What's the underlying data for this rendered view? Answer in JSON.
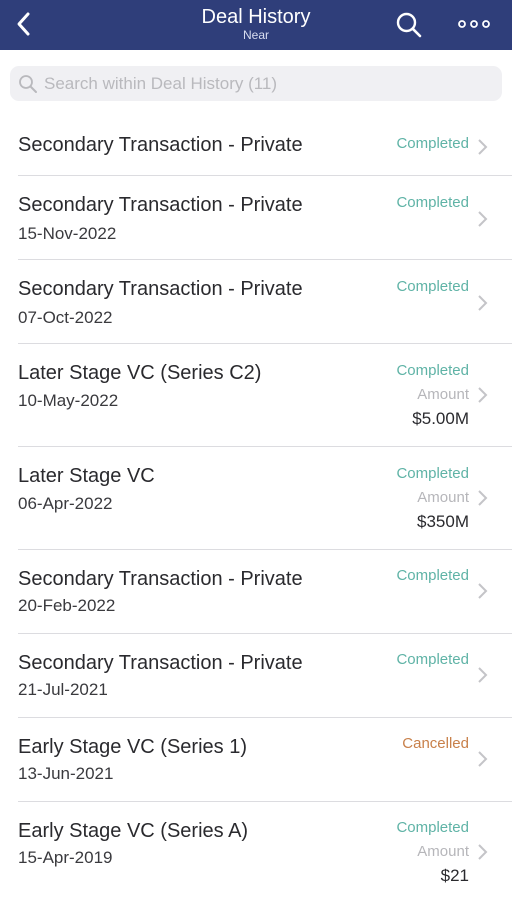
{
  "header": {
    "title": "Deal History",
    "subtitle": "Near",
    "back_icon": "chevron-left-icon",
    "search_icon": "search-icon",
    "more_icon": "more-horizontal-icon",
    "bar_color": "#2f3e7a"
  },
  "search": {
    "placeholder": "Search within Deal History (11)",
    "value": ""
  },
  "deals": [
    {
      "type": "Secondary Transaction - Private",
      "date": "",
      "status": "Completed",
      "amount_label": "",
      "amount": ""
    },
    {
      "type": "Secondary Transaction - Private",
      "date": "15-Nov-2022",
      "status": "Completed",
      "amount_label": "",
      "amount": ""
    },
    {
      "type": "Secondary Transaction - Private",
      "date": "07-Oct-2022",
      "status": "Completed",
      "amount_label": "",
      "amount": ""
    },
    {
      "type": "Later Stage VC (Series C2)",
      "date": "10-May-2022",
      "status": "Completed",
      "amount_label": "Amount",
      "amount": "$5.00M"
    },
    {
      "type": "Later Stage VC",
      "date": "06-Apr-2022",
      "status": "Completed",
      "amount_label": "Amount",
      "amount": "$350M"
    },
    {
      "type": "Secondary Transaction - Private",
      "date": "20-Feb-2022",
      "status": "Completed",
      "amount_label": "",
      "amount": ""
    },
    {
      "type": "Secondary Transaction - Private",
      "date": "21-Jul-2021",
      "status": "Completed",
      "amount_label": "",
      "amount": ""
    },
    {
      "type": "Early Stage VC (Series 1)",
      "date": "13-Jun-2021",
      "status": "Cancelled",
      "amount_label": "",
      "amount": ""
    },
    {
      "type": "Early Stage VC (Series A)",
      "date": "15-Apr-2019",
      "status": "Completed",
      "amount_label": "Amount",
      "amount": "$21"
    }
  ],
  "colors": {
    "completed": "#5fb3a6",
    "cancelled": "#c8804a"
  }
}
